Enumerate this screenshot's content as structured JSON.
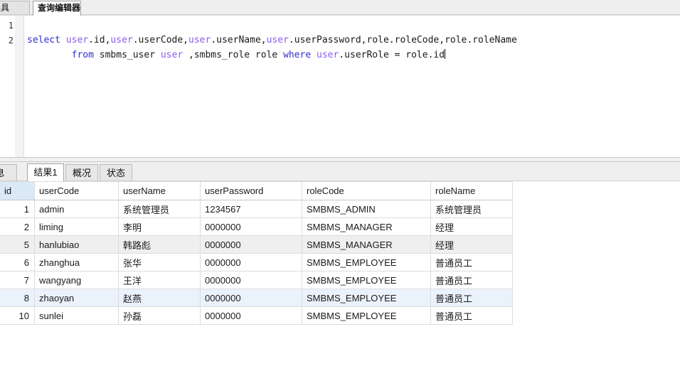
{
  "window": {
    "editor_tabs": [
      {
        "label": "询创建工具",
        "active": false,
        "name": "tab-query-builder"
      },
      {
        "label": "查询编辑器",
        "active": true,
        "name": "tab-query-editor"
      }
    ]
  },
  "editor": {
    "line_numbers": [
      "1",
      "2"
    ],
    "sql_lines": [
      [
        {
          "t": "select ",
          "k": "kw"
        },
        {
          "t": "user",
          "k": "alias"
        },
        {
          "t": ".id,",
          "k": ""
        },
        {
          "t": "user",
          "k": "alias"
        },
        {
          "t": ".userCode,",
          "k": ""
        },
        {
          "t": "user",
          "k": "alias"
        },
        {
          "t": ".userName,",
          "k": ""
        },
        {
          "t": "user",
          "k": "alias"
        },
        {
          "t": ".userPassword,role.roleCode,role.roleName",
          "k": ""
        }
      ],
      [
        {
          "t": "        ",
          "k": ""
        },
        {
          "t": "from",
          "k": "kw"
        },
        {
          "t": " smbms_user ",
          "k": ""
        },
        {
          "t": "user",
          "k": "alias"
        },
        {
          "t": " ,smbms_role role ",
          "k": ""
        },
        {
          "t": "where",
          "k": "kw"
        },
        {
          "t": " ",
          "k": ""
        },
        {
          "t": "user",
          "k": "alias"
        },
        {
          "t": ".userRole = role.id",
          "k": ""
        }
      ]
    ],
    "sql_plain": "select user.id,user.userCode,user.userName,user.userPassword,role.roleCode,role.roleName\n        from smbms_user user ,smbms_role role where user.userRole = role.id",
    "colors": {
      "keyword": "#2f2fd0",
      "alias": "#8b5cf0",
      "text": "#1a1a1a"
    }
  },
  "results": {
    "tabs": [
      {
        "label": "息",
        "active": false,
        "name": "result-tab-info"
      },
      {
        "label": "结果1",
        "active": true,
        "name": "result-tab-result1"
      },
      {
        "label": "概况",
        "active": false,
        "name": "result-tab-profile"
      },
      {
        "label": "状态",
        "active": false,
        "name": "result-tab-status"
      }
    ],
    "columns": [
      "id",
      "userCode",
      "userName",
      "userPassword",
      "roleCode",
      "roleName"
    ],
    "selected_column": "id",
    "rows": [
      {
        "id": "1",
        "userCode": "admin",
        "userName": "系统管理员",
        "userPassword": "1234567",
        "roleCode": "SMBMS_ADMIN",
        "roleName": "系统管理员",
        "state": ""
      },
      {
        "id": "2",
        "userCode": "liming",
        "userName": "李明",
        "userPassword": "0000000",
        "roleCode": "SMBMS_MANAGER",
        "roleName": "经理",
        "state": ""
      },
      {
        "id": "5",
        "userCode": "hanlubiao",
        "userName": "韩路彪",
        "userPassword": "0000000",
        "roleCode": "SMBMS_MANAGER",
        "roleName": "经理",
        "state": "alt"
      },
      {
        "id": "6",
        "userCode": "zhanghua",
        "userName": "张华",
        "userPassword": "0000000",
        "roleCode": "SMBMS_EMPLOYEE",
        "roleName": "普通员工",
        "state": ""
      },
      {
        "id": "7",
        "userCode": "wangyang",
        "userName": "王洋",
        "userPassword": "0000000",
        "roleCode": "SMBMS_EMPLOYEE",
        "roleName": "普通员工",
        "state": ""
      },
      {
        "id": "8",
        "userCode": "zhaoyan",
        "userName": "赵燕",
        "userPassword": "0000000",
        "roleCode": "SMBMS_EMPLOYEE",
        "roleName": "普通员工",
        "state": "sel"
      },
      {
        "id": "10",
        "userCode": "sunlei",
        "userName": "孙磊",
        "userPassword": "0000000",
        "roleCode": "SMBMS_EMPLOYEE",
        "roleName": "普通员工",
        "state": ""
      }
    ],
    "colors": {
      "column_selected": "#dbe8f6",
      "row_alt": "#efefef",
      "row_selected": "#eaf2fb",
      "grid_line": "#dcdcdc"
    }
  }
}
